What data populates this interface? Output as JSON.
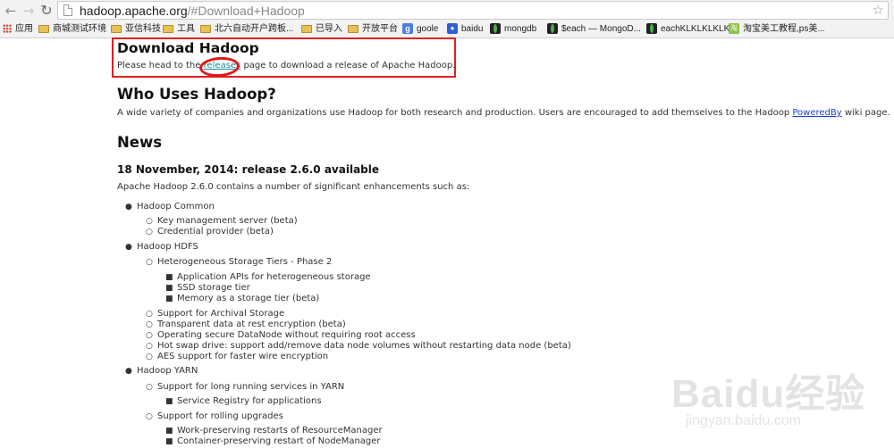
{
  "browser": {
    "url_host": "hadoop.apache.org",
    "url_path": "/#Download+Hadoop"
  },
  "bookmarks": [
    {
      "label": "应用",
      "icon": "apps-grid-icon"
    },
    {
      "label": "商城测试环境",
      "icon": "folder-icon"
    },
    {
      "label": "亚信科技",
      "icon": "folder-icon"
    },
    {
      "label": "工具",
      "icon": "folder-icon"
    },
    {
      "label": "北六自动开户跨板...",
      "icon": "folder-icon"
    },
    {
      "label": "已导入",
      "icon": "folder-icon"
    },
    {
      "label": "开放平台",
      "icon": "folder-icon"
    },
    {
      "label": "goole",
      "icon": "google-icon"
    },
    {
      "label": "baidu",
      "icon": "baidu-paw-icon"
    },
    {
      "label": "mongdb",
      "icon": "mongodb-leaf-icon"
    },
    {
      "label": "$each — MongoD...",
      "icon": "mongodb-leaf-icon"
    },
    {
      "label": "eachKLKLKLKLK",
      "icon": "mongodb-leaf-icon"
    },
    {
      "label": "淘宝美工教程,ps美...",
      "icon": "taobao-icon"
    }
  ],
  "page": {
    "download_heading": "Download Hadoop",
    "download_text_before": "Please head to the ",
    "download_link": "releases",
    "download_text_after": " page to download a release of Apache Hadoop.",
    "who_heading": "Who Uses Hadoop?",
    "who_text_before": "A wide variety of companies and organizations use Hadoop for both research and production. Users are encouraged to add themselves to the Hadoop ",
    "who_link": "PoweredBy",
    "who_text_after": " wiki page.",
    "news_heading": "News",
    "release_heading": "18 November, 2014: release 2.6.0 available",
    "release_intro": "Apache Hadoop 2.6.0 contains a number of significant enhancements such as:",
    "list": {
      "common": "Hadoop Common",
      "common_kms": "Key management server (beta)",
      "common_cred": "Credential provider (beta)",
      "hdfs": "Hadoop HDFS",
      "hdfs_tiers": "Heterogeneous Storage Tiers - Phase 2",
      "hdfs_tiers_api": "Application APIs for heterogeneous storage",
      "hdfs_tiers_ssd": "SSD storage tier",
      "hdfs_tiers_mem": "Memory as a storage tier (beta)",
      "hdfs_archival": "Support for Archival Storage",
      "hdfs_encrypt": "Transparent data at rest encryption (beta)",
      "hdfs_secure": "Operating secure DataNode without requiring root access",
      "hdfs_hotswap": "Hot swap drive: support add/remove data node volumes without restarting data node (beta)",
      "hdfs_aes": "AES support for faster wire encryption",
      "yarn": "Hadoop YARN",
      "yarn_long": "Support for long running services in YARN",
      "yarn_registry": "Service Registry for applications",
      "yarn_rolling": "Support for rolling upgrades",
      "yarn_rm": "Work-preserving restarts of ResourceManager",
      "yarn_nm": "Container-preserving restart of NodeManager"
    }
  },
  "watermark": {
    "logo": "Baidu经验",
    "site": "jingyan.baidu.com"
  }
}
